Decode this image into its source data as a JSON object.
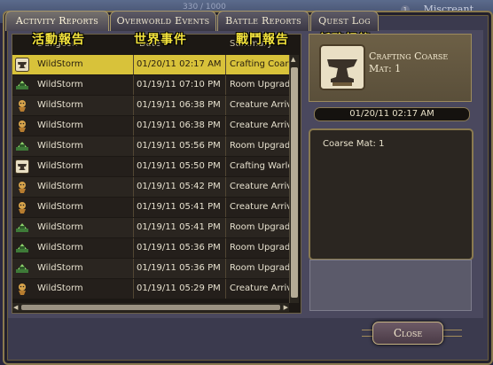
{
  "hud": {
    "counter": "330 / 1000",
    "player_name": "Miscreant",
    "badge": "1"
  },
  "tabs": [
    {
      "label": "Activity Reports"
    },
    {
      "label": "Overworld Events"
    },
    {
      "label": "Battle Reports"
    },
    {
      "label": "Quest Log"
    }
  ],
  "translations": [
    "活動報告",
    "世界事件",
    "戰鬥報告",
    "任務紀錄"
  ],
  "columns": {
    "dungeon": "Dungeon",
    "date": "Date",
    "summary": "Summary"
  },
  "rows": [
    {
      "icon": "crafting-anvil-icon",
      "dungeon": "WildStorm",
      "date": "01/20/11 02:17 AM",
      "summary": "Crafting Coarse",
      "selected": true
    },
    {
      "icon": "room-upgrade-icon",
      "dungeon": "WildStorm",
      "date": "01/19/11 07:10 PM",
      "summary": "Room Upgrade"
    },
    {
      "icon": "creature-arrival-icon",
      "dungeon": "WildStorm",
      "date": "01/19/11 06:38 PM",
      "summary": "Creature Arrival"
    },
    {
      "icon": "creature-arrival-icon",
      "dungeon": "WildStorm",
      "date": "01/19/11 06:38 PM",
      "summary": "Creature Arrival"
    },
    {
      "icon": "room-upgrade-icon",
      "dungeon": "WildStorm",
      "date": "01/19/11 05:56 PM",
      "summary": "Room Upgrade"
    },
    {
      "icon": "crafting-anvil-icon",
      "dungeon": "WildStorm",
      "date": "01/19/11 05:50 PM",
      "summary": "Crafting Warlock"
    },
    {
      "icon": "creature-arrival-icon",
      "dungeon": "WildStorm",
      "date": "01/19/11 05:42 PM",
      "summary": "Creature Arrival"
    },
    {
      "icon": "creature-arrival-icon",
      "dungeon": "WildStorm",
      "date": "01/19/11 05:41 PM",
      "summary": "Creature Arrival"
    },
    {
      "icon": "room-upgrade-icon",
      "dungeon": "WildStorm",
      "date": "01/19/11 05:41 PM",
      "summary": "Room Upgrade"
    },
    {
      "icon": "room-upgrade-icon",
      "dungeon": "WildStorm",
      "date": "01/19/11 05:36 PM",
      "summary": "Room Upgrade"
    },
    {
      "icon": "room-upgrade-icon",
      "dungeon": "WildStorm",
      "date": "01/19/11 05:36 PM",
      "summary": "Room Upgrade"
    },
    {
      "icon": "creature-arrival-icon",
      "dungeon": "WildStorm",
      "date": "01/19/11 05:29 PM",
      "summary": "Creature Arrival"
    }
  ],
  "detail": {
    "icon": "crafting-anvil-icon",
    "title_line1": "Crafting Coarse",
    "title_line2": "Mat: 1",
    "date": "01/20/11 02:17 AM",
    "description": "Coarse Mat: 1"
  },
  "close_label": "Close",
  "colors": {
    "selected_row": "#d8c23a",
    "translation_text": "#f2e23c",
    "frame_gold": "#8a7a4f"
  }
}
